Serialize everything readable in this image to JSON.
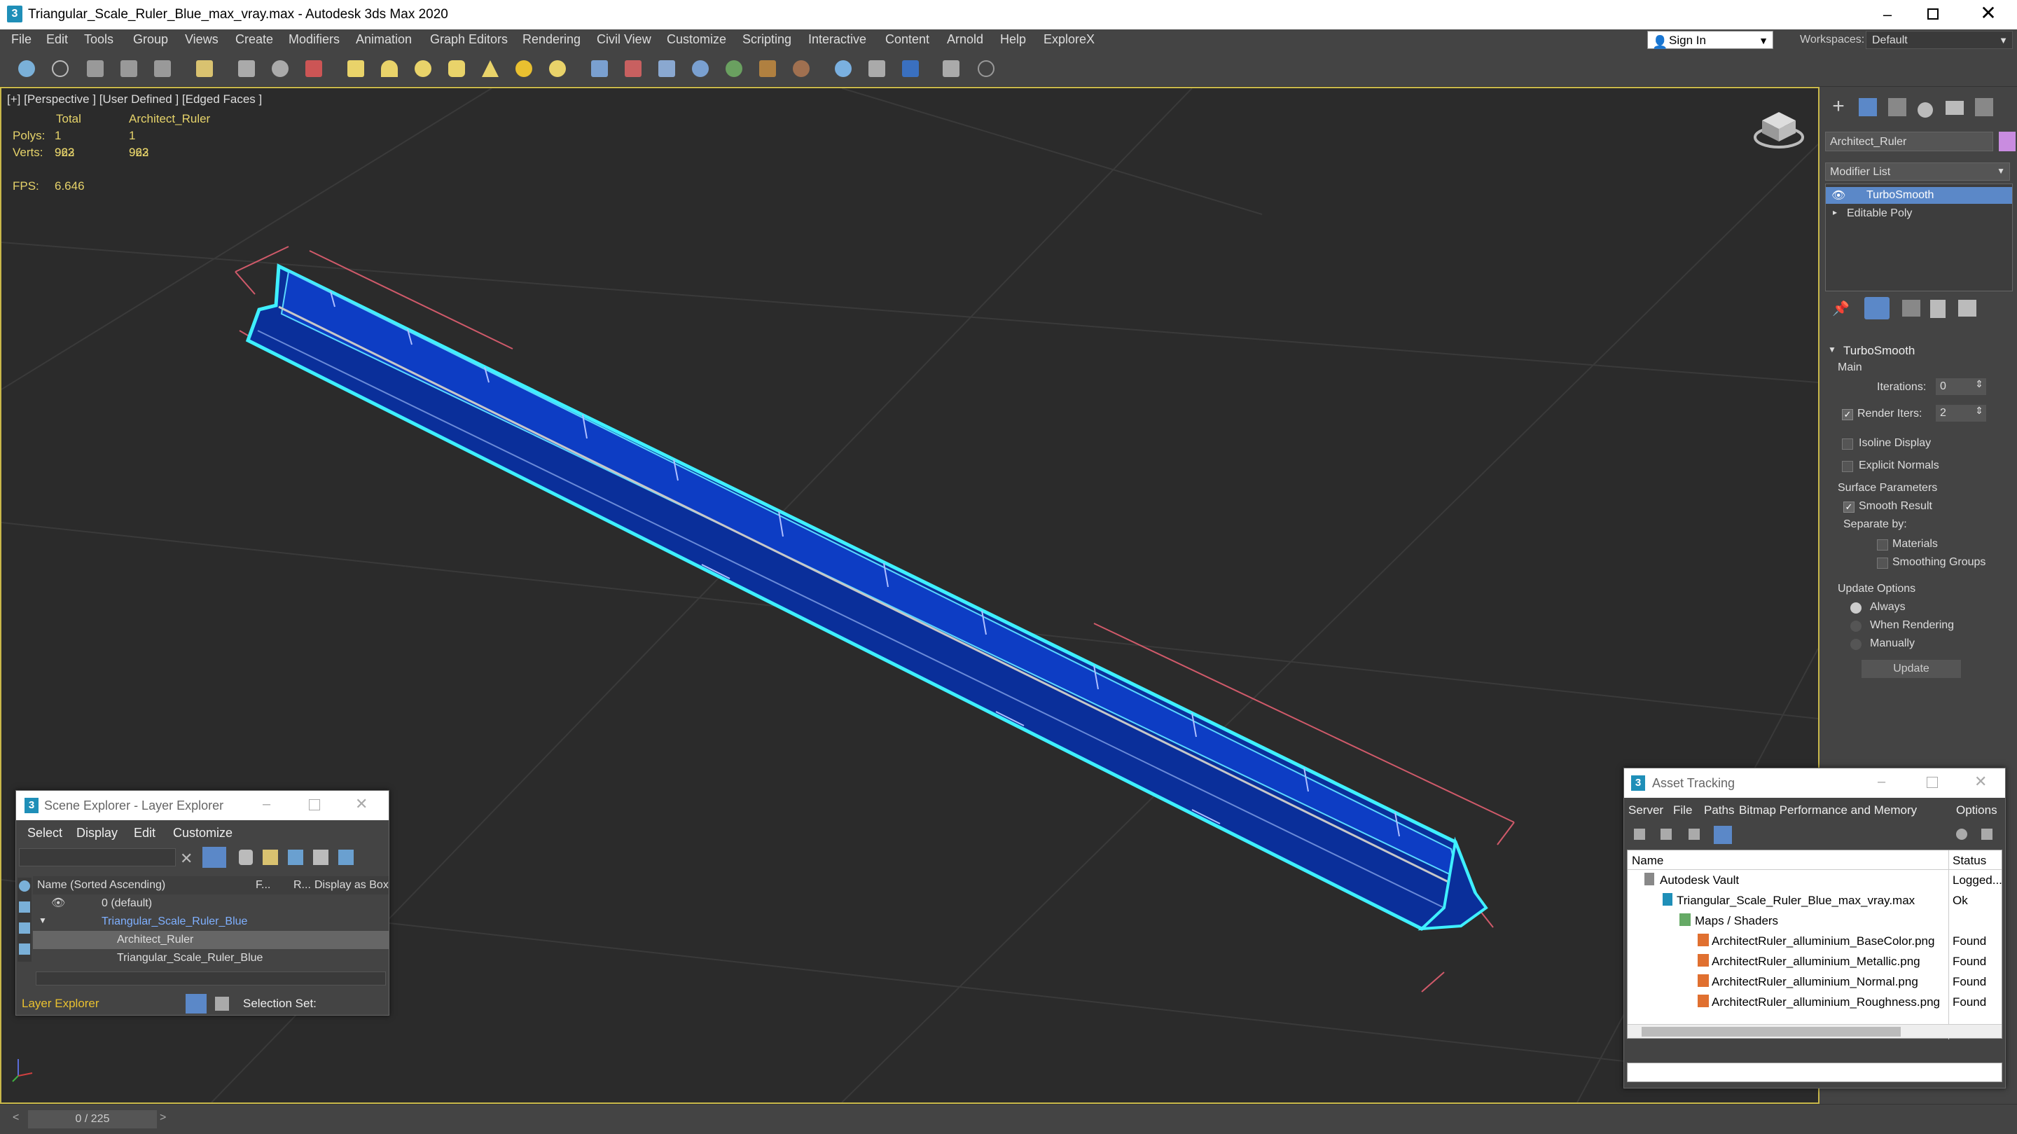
{
  "window": {
    "title": "Triangular_Scale_Ruler_Blue_max_vray.max - Autodesk 3ds Max 2020",
    "app_icon": "3"
  },
  "menu": [
    "File",
    "Edit",
    "Tools",
    "Group",
    "Views",
    "Create",
    "Modifiers",
    "Animation",
    "Graph Editors",
    "Rendering",
    "Civil View",
    "Customize",
    "Scripting",
    "Interactive",
    "Content",
    "Arnold",
    "Help",
    "ExploreX"
  ],
  "signin": "Sign In",
  "workspaces_label": "Workspaces:",
  "workspace": "Default",
  "viewport": {
    "label": "[+] [Perspective ] [User Defined ] [Edged Faces ]",
    "stats": {
      "total_hdr": "Total",
      "obj_hdr": "Architect_Ruler",
      "polys_label": "Polys:",
      "polys_total": "1 922",
      "polys_obj": "1 922",
      "verts_label": "Verts:",
      "verts_total": "963",
      "verts_obj": "963",
      "fps_label": "FPS:",
      "fps": "6.646"
    }
  },
  "command_panel": {
    "object_name": "Architect_Ruler",
    "object_color": "#c98ce0",
    "modifier_list": "Modifier List",
    "stack": [
      "TurboSmooth",
      "Editable Poly"
    ],
    "rollout_title": "TurboSmooth",
    "main": "Main",
    "iterations_label": "Iterations:",
    "iterations": "0",
    "render_iters_label": "Render Iters:",
    "render_iters": "2",
    "isoline": "Isoline Display",
    "explicit": "Explicit Normals",
    "surface_params": "Surface Parameters",
    "smooth_result": "Smooth Result",
    "separate_by": "Separate by:",
    "materials": "Materials",
    "smoothing_groups": "Smoothing Groups",
    "update_options": "Update Options",
    "always": "Always",
    "when_rendering": "When Rendering",
    "manually": "Manually",
    "update_btn": "Update"
  },
  "scene_explorer": {
    "title": "Scene Explorer - Layer Explorer",
    "menu": [
      "Select",
      "Display",
      "Edit",
      "Customize"
    ],
    "col_name": "Name (Sorted Ascending)",
    "col_f": "F...",
    "col_r": "R...",
    "col_box": "Display as Box",
    "rows": [
      "0 (default)",
      "Triangular_Scale_Ruler_Blue",
      "Architect_Ruler",
      "Triangular_Scale_Ruler_Blue"
    ],
    "footer_left": "Layer Explorer",
    "footer_right": "Selection Set:"
  },
  "asset_tracking": {
    "title": "Asset Tracking",
    "menu": [
      "Server",
      "File",
      "Paths",
      "Bitmap Performance and Memory",
      "Options"
    ],
    "col_name": "Name",
    "col_status": "Status",
    "rows": [
      {
        "name": "Autodesk Vault",
        "status": "Logged..."
      },
      {
        "name": "Triangular_Scale_Ruler_Blue_max_vray.max",
        "status": "Ok"
      },
      {
        "name": "Maps / Shaders",
        "status": ""
      },
      {
        "name": "ArchitectRuler_alluminium_BaseColor.png",
        "status": "Found"
      },
      {
        "name": "ArchitectRuler_alluminium_Metallic.png",
        "status": "Found"
      },
      {
        "name": "ArchitectRuler_alluminium_Normal.png",
        "status": "Found"
      },
      {
        "name": "ArchitectRuler_alluminium_Roughness.png",
        "status": "Found"
      }
    ]
  },
  "timeline": {
    "frame": "0 / 225"
  }
}
